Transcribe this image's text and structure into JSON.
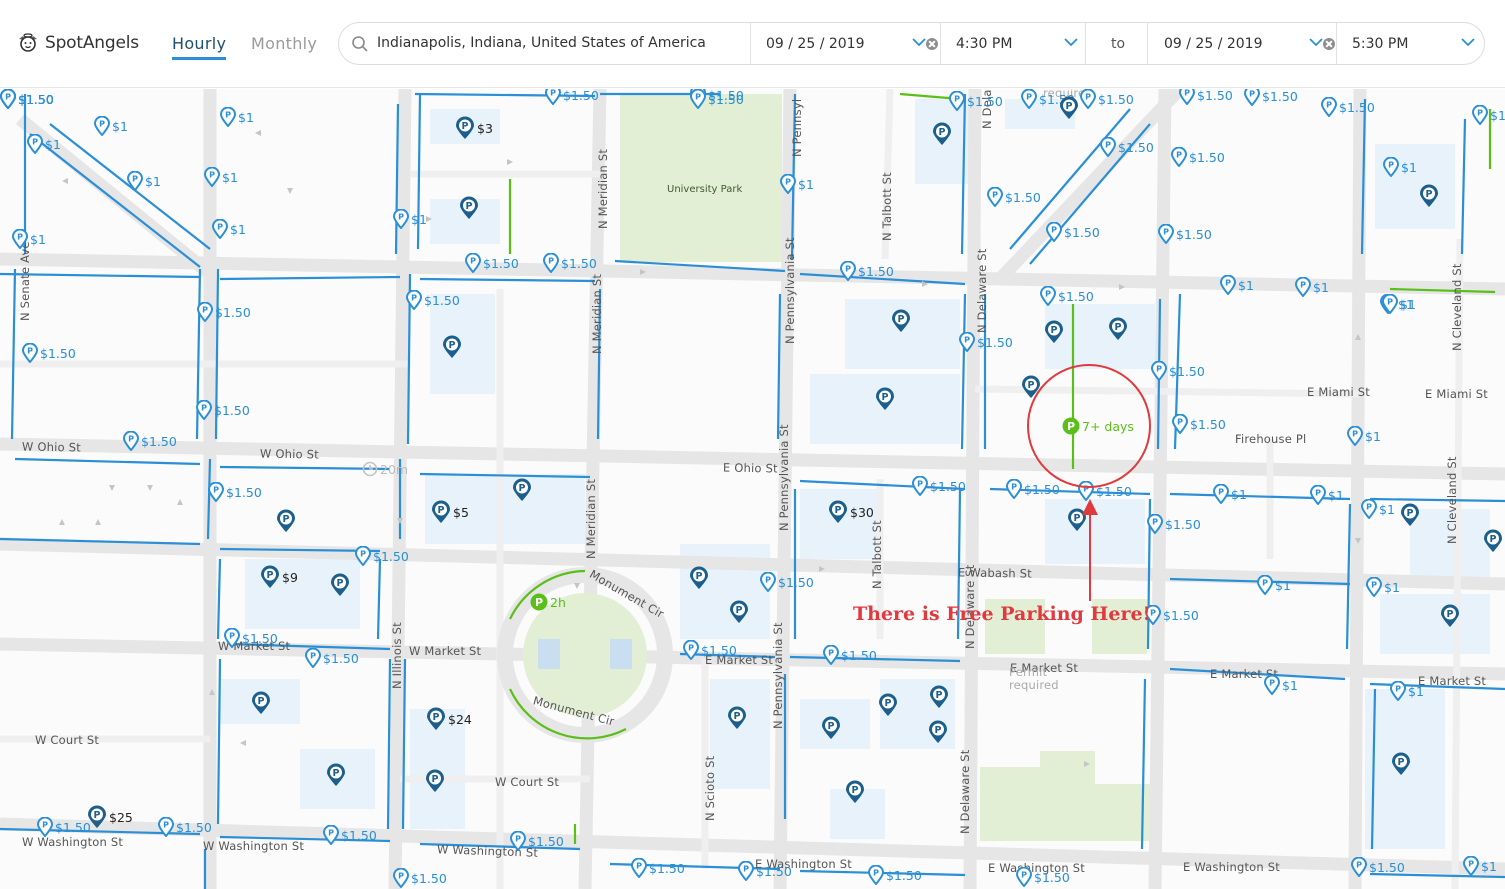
{
  "app": {
    "name": "SpotAngels"
  },
  "tabs": {
    "hourly": "Hourly",
    "monthly": "Monthly",
    "active": "Hourly"
  },
  "search": {
    "location": "Indianapolis, Indiana, United States of America"
  },
  "start": {
    "date": "09 / 25 / 2019",
    "time": "4:30 PM"
  },
  "to_label": "to",
  "end": {
    "date": "09 / 25 / 2019",
    "time": "5:30 PM"
  },
  "colors": {
    "street_parking": "#2a8fd6",
    "garage": "#1d5f8c",
    "free": "#5bbf1a",
    "annotation": "#e03a3e",
    "park": "#e2efd5",
    "building": "#e8f2fb"
  },
  "street_labels": {
    "n_senate": "N Senate Ave",
    "n_meridian_top": "N Meridian St",
    "n_meridian_mid": "N Meridian St",
    "n_meridian_bot": "N Meridian St",
    "n_penn_top": "N Pennsyl",
    "n_penn_mid": "N Pennsylvania St",
    "n_penn_mid2": "N Pennsylvania St",
    "n_penn_bot": "N Pennsylvania St",
    "n_talbott_top": "N Talbott St",
    "n_talbott_bot": "N Talbott St",
    "n_delaware_top": "N Dela",
    "n_delaware_mid": "N Delaware St",
    "n_delaware_mid2": "N Delaware St",
    "n_delaware_bot": "N Delaware St",
    "n_illinois": "N Illinois St",
    "n_scioto": "N Scioto St",
    "n_cleveland_top": "N Cleveland St",
    "n_cleveland_bot": "N Cleveland St",
    "w_ohio_left": "W Ohio St",
    "w_ohio_mid": "W Ohio St",
    "e_ohio": "E Ohio St",
    "e_miami_1": "E Miami St",
    "e_miami_2": "E Miami St",
    "firehouse": "Firehouse Pl",
    "e_wabash": "E Wabash St",
    "w_market_1": "W Market St",
    "w_market_2": "W Market St",
    "e_market_1": "E Market St",
    "e_market_2": "E Market St",
    "e_market_3": "E Market St",
    "e_market_4": "E Market St",
    "monument_top": "Monument Cir",
    "monument_bot": "Monument Cir",
    "w_court_1": "W Court St",
    "w_court_2": "W Court St",
    "w_washington_1": "W Washington St",
    "w_washington_2": "W Washington St",
    "w_washington_3": "W Washington St",
    "e_washington_1": "E Washington St",
    "e_washington_2": "E Washington St",
    "e_washington_3": "E Washington St",
    "permit_1": "required",
    "permit_2a": "Permit",
    "permit_2b": "required"
  },
  "parks": {
    "university_park": "University Park"
  },
  "pins": [
    {
      "kind": "street",
      "price": "$1"
    },
    {
      "kind": "street",
      "price": "$1"
    },
    {
      "kind": "street",
      "price": "$1"
    },
    {
      "kind": "street",
      "price": "$1"
    },
    {
      "kind": "street",
      "price": "$1"
    },
    {
      "kind": "street",
      "price": "$1"
    },
    {
      "kind": "street",
      "price": "$1"
    },
    {
      "kind": "street",
      "price": "$1"
    },
    {
      "kind": "street",
      "price": "$1.50"
    },
    {
      "kind": "street",
      "price": "$1.50"
    },
    {
      "kind": "street",
      "price": "$1.50"
    },
    {
      "kind": "street",
      "price": "$1.50"
    },
    {
      "kind": "street",
      "price": "$1.50"
    },
    {
      "kind": "street",
      "price": "$1.50"
    },
    {
      "kind": "street",
      "price": "$1.50"
    },
    {
      "kind": "street",
      "price": "$1.50"
    },
    {
      "kind": "street",
      "price": "$1.50"
    },
    {
      "kind": "street",
      "price": "$1.50"
    },
    {
      "kind": "street",
      "price": "$1.50"
    },
    {
      "kind": "street",
      "price": "$1.50"
    },
    {
      "kind": "street",
      "price": "$1"
    },
    {
      "kind": "street",
      "price": "$1.50"
    },
    {
      "kind": "street",
      "price": "$1.50"
    },
    {
      "kind": "street",
      "price": "$1.50"
    },
    {
      "kind": "street",
      "price": "$1.50"
    },
    {
      "kind": "street",
      "price": "$1.50"
    },
    {
      "kind": "street",
      "price": "$1.50"
    },
    {
      "kind": "street",
      "price": "$1.50"
    },
    {
      "kind": "street",
      "price": "$1.50"
    },
    {
      "kind": "street",
      "price": "$1.50"
    },
    {
      "kind": "street",
      "price": "$1.50"
    },
    {
      "kind": "street",
      "price": "$1.50"
    },
    {
      "kind": "street",
      "price": "$1.50"
    },
    {
      "kind": "street",
      "price": "$1.50"
    },
    {
      "kind": "street",
      "price": "$1.50"
    },
    {
      "kind": "street",
      "price": "$1.50"
    },
    {
      "kind": "street",
      "price": "$1.50"
    },
    {
      "kind": "street",
      "price": "$1.50"
    },
    {
      "kind": "street",
      "price": "$1.50"
    },
    {
      "kind": "street",
      "price": "$1.50"
    },
    {
      "kind": "street",
      "price": "$1.50"
    },
    {
      "kind": "street",
      "price": "$1.50"
    },
    {
      "kind": "street",
      "price": "$1.50"
    },
    {
      "kind": "street",
      "price": "$1.50"
    },
    {
      "kind": "street",
      "price": "$1.50"
    },
    {
      "kind": "street",
      "price": "$1.50"
    },
    {
      "kind": "street",
      "price": "$1.50"
    },
    {
      "kind": "street",
      "price": "$1.50"
    },
    {
      "kind": "street",
      "price": "$1.50"
    },
    {
      "kind": "street",
      "price": "$1.50"
    },
    {
      "kind": "street",
      "price": "$1"
    },
    {
      "kind": "street",
      "price": "$1"
    },
    {
      "kind": "street",
      "price": "$1"
    },
    {
      "kind": "street",
      "price": "$1"
    },
    {
      "kind": "street",
      "price": "$1"
    },
    {
      "kind": "street",
      "price": "$1"
    },
    {
      "kind": "street",
      "price": "$1"
    },
    {
      "kind": "street",
      "price": "$1"
    },
    {
      "kind": "street",
      "price": "$1"
    },
    {
      "kind": "street",
      "price": "$1"
    },
    {
      "kind": "street",
      "price": "$1"
    },
    {
      "kind": "street",
      "price": "$1"
    },
    {
      "kind": "street",
      "price": "$1"
    },
    {
      "kind": "street",
      "price": "$1.50"
    },
    {
      "kind": "street",
      "price": "$1.50"
    },
    {
      "kind": "street",
      "price": "$1.50"
    },
    {
      "kind": "street",
      "price": "$1.50"
    },
    {
      "kind": "street",
      "price": "$1.50"
    },
    {
      "kind": "street",
      "price": "$1.50"
    },
    {
      "kind": "street",
      "price": "$1.50"
    },
    {
      "kind": "street",
      "price": "$1.50"
    },
    {
      "kind": "street",
      "price": "$1.50"
    },
    {
      "kind": "street",
      "price": "$1.50"
    },
    {
      "kind": "street",
      "price": "$1.50"
    },
    {
      "kind": "street",
      "price": "$1.50"
    },
    {
      "kind": "street",
      "price": "$1.50"
    },
    {
      "kind": "street",
      "price": "$1.50"
    },
    {
      "kind": "street",
      "price": "$1.50"
    },
    {
      "kind": "street",
      "price": "$1"
    },
    {
      "kind": "garage",
      "price": "$3"
    },
    {
      "kind": "garage",
      "price": "$5"
    },
    {
      "kind": "garage",
      "price": "$30"
    },
    {
      "kind": "garage",
      "price": "$9"
    },
    {
      "kind": "garage",
      "price": "$24"
    },
    {
      "kind": "garage",
      "price": "$25"
    },
    {
      "kind": "garage",
      "price": ""
    },
    {
      "kind": "garage",
      "price": ""
    },
    {
      "kind": "garage",
      "price": ""
    },
    {
      "kind": "garage",
      "price": ""
    },
    {
      "kind": "garage",
      "price": ""
    },
    {
      "kind": "garage",
      "price": ""
    },
    {
      "kind": "garage",
      "price": ""
    },
    {
      "kind": "garage",
      "price": ""
    },
    {
      "kind": "garage",
      "price": ""
    },
    {
      "kind": "garage",
      "price": ""
    },
    {
      "kind": "garage",
      "price": ""
    },
    {
      "kind": "garage",
      "price": ""
    },
    {
      "kind": "garage",
      "price": ""
    },
    {
      "kind": "garage",
      "price": ""
    },
    {
      "kind": "garage",
      "price": ""
    },
    {
      "kind": "garage",
      "price": ""
    },
    {
      "kind": "garage",
      "price": ""
    },
    {
      "kind": "garage",
      "price": ""
    },
    {
      "kind": "garage",
      "price": ""
    },
    {
      "kind": "garage",
      "price": ""
    },
    {
      "kind": "garage",
      "price": ""
    },
    {
      "kind": "garage",
      "price": ""
    },
    {
      "kind": "garage",
      "price": ""
    },
    {
      "kind": "garage",
      "price": ""
    },
    {
      "kind": "garage",
      "price": ""
    },
    {
      "kind": "garage",
      "price": ""
    },
    {
      "kind": "garage",
      "price": ""
    },
    {
      "kind": "garage",
      "price": ""
    },
    {
      "kind": "garage",
      "price": ""
    },
    {
      "kind": "free",
      "price": "7+ days"
    },
    {
      "kind": "free",
      "price": "2h"
    },
    {
      "kind": "limit",
      "price": "20m"
    }
  ],
  "annotation": {
    "text": "There is Free Parking Here!"
  }
}
